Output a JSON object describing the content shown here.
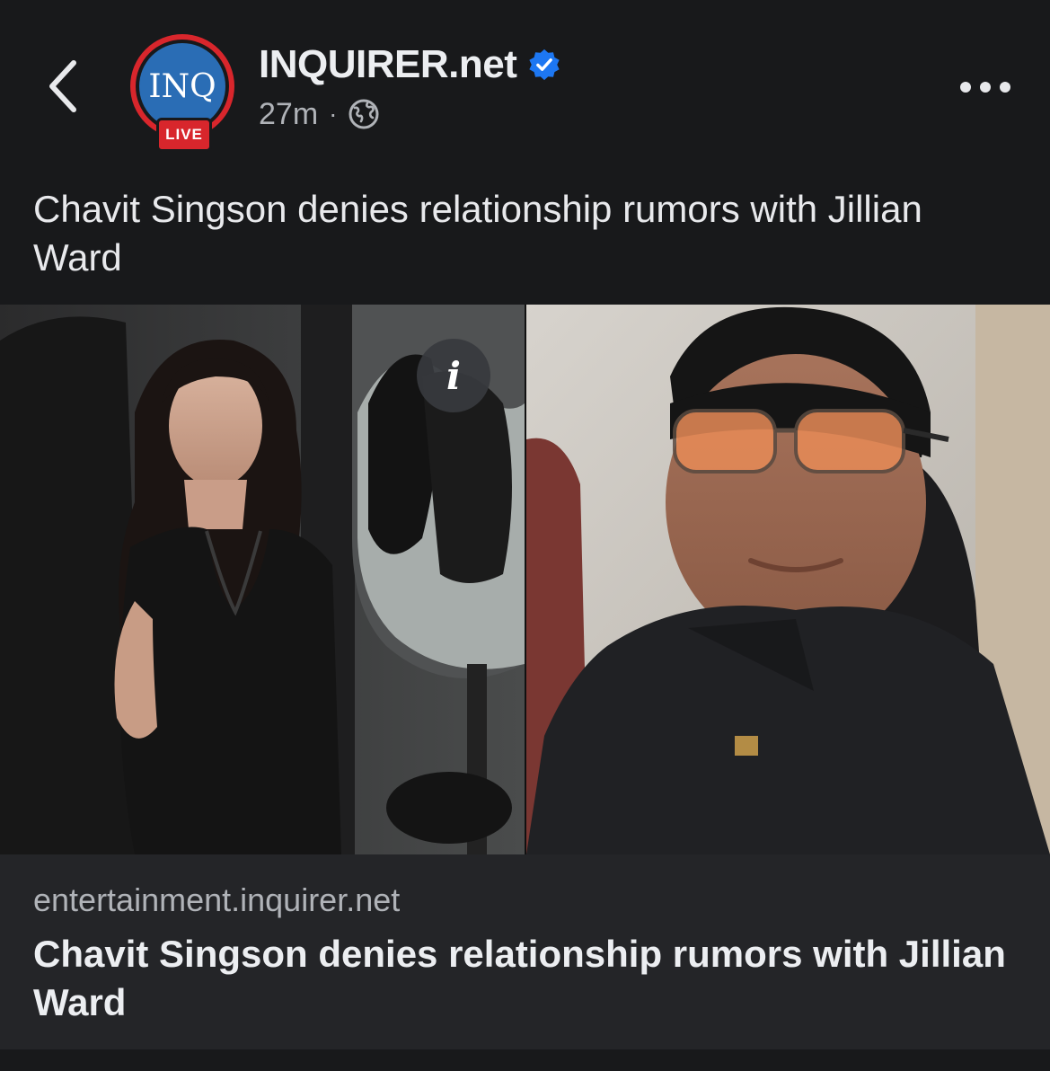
{
  "header": {
    "page_name": "INQUIRER.net",
    "avatar_text": "INQ",
    "live_badge": "LIVE",
    "time_ago": "27m",
    "separator": "·"
  },
  "post": {
    "text": "Chavit Singson denies relationship rumors with Jillian Ward"
  },
  "link_preview": {
    "domain": "entertainment.inquirer.net",
    "title": "Chavit Singson denies relationship rumors with Jillian Ward"
  },
  "icons": {
    "back": "chevron-left-icon",
    "verified": "verified-badge-icon",
    "audience": "globe-icon",
    "more": "more-horizontal-icon",
    "info": "info-icon"
  },
  "colors": {
    "background": "#18191b",
    "card": "#242528",
    "verified_blue": "#1d77f2",
    "live_red": "#d8262c",
    "brand_blue": "#2a6db5"
  }
}
